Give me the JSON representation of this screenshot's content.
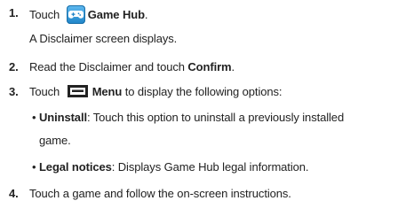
{
  "steps": [
    {
      "number": "1.",
      "pre": "Touch",
      "icon": "game-hub-icon",
      "bold": "Game Hub",
      "post": ".",
      "note": "A Disclaimer screen displays."
    },
    {
      "number": "2.",
      "pre": "Read the Disclaimer and touch ",
      "bold": "Confirm",
      "post": "."
    },
    {
      "number": "3.",
      "pre": "Touch",
      "icon": "menu-icon",
      "bold": "Menu",
      "post": " to display the following options:",
      "options": [
        {
          "bullet": "•",
          "bold": "Uninstall",
          "text": ": Touch this option to uninstall a previously installed",
          "text_cont": "game."
        },
        {
          "bullet": "•",
          "bold": "Legal notices",
          "text": ": Displays Game Hub legal information."
        }
      ]
    },
    {
      "number": "4.",
      "pre": "Touch a game and follow the on-screen instructions."
    }
  ]
}
